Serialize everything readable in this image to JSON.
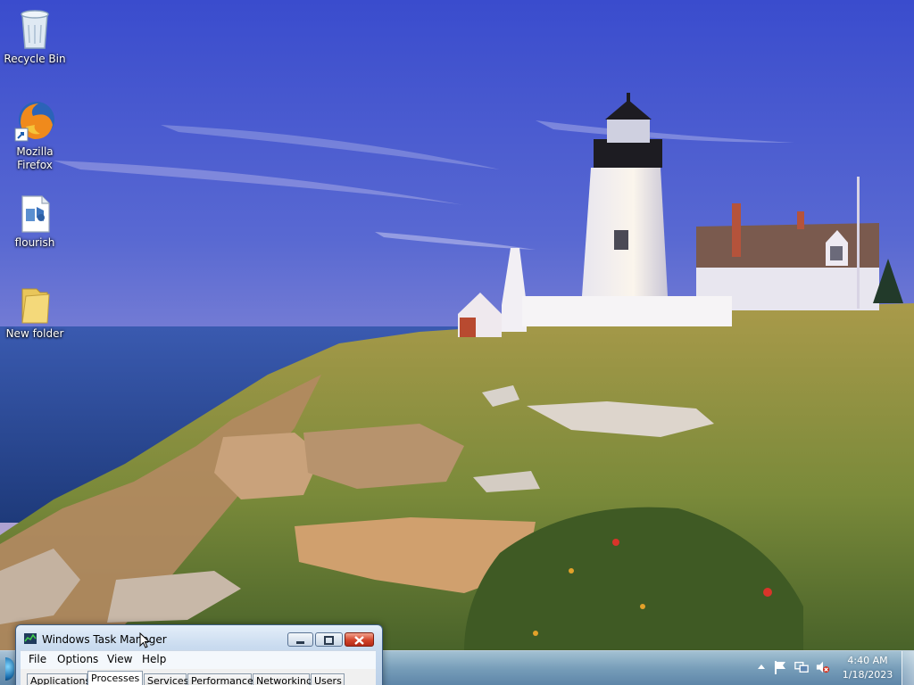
{
  "desktop": {
    "icons": [
      {
        "label": "Recycle Bin",
        "icon": "recycle-bin-icon"
      },
      {
        "label": "Mozilla Firefox",
        "icon": "firefox-icon"
      },
      {
        "label": "flourish",
        "icon": "media-file-icon"
      },
      {
        "label": "New folder",
        "icon": "folder-icon"
      }
    ]
  },
  "task_manager": {
    "title": "Windows Task Manager",
    "menu": [
      "File",
      "Options",
      "View",
      "Help"
    ],
    "tabs": [
      "Applications",
      "Processes",
      "Services",
      "Performance",
      "Networking",
      "Users"
    ],
    "active_tab": "Processes"
  },
  "taskbar": {
    "clock_time": "4:40 AM",
    "clock_date": "1/18/2023",
    "tray_icons": [
      "show-hidden-icons-icon",
      "action-center-flag-icon",
      "network-icon",
      "volume-muted-icon"
    ]
  },
  "colors": {
    "sky_top": "#3a4fc4",
    "sea": "#2b4f9a",
    "taskbar": "#7fa4c8",
    "close_button": "#d2432a"
  }
}
